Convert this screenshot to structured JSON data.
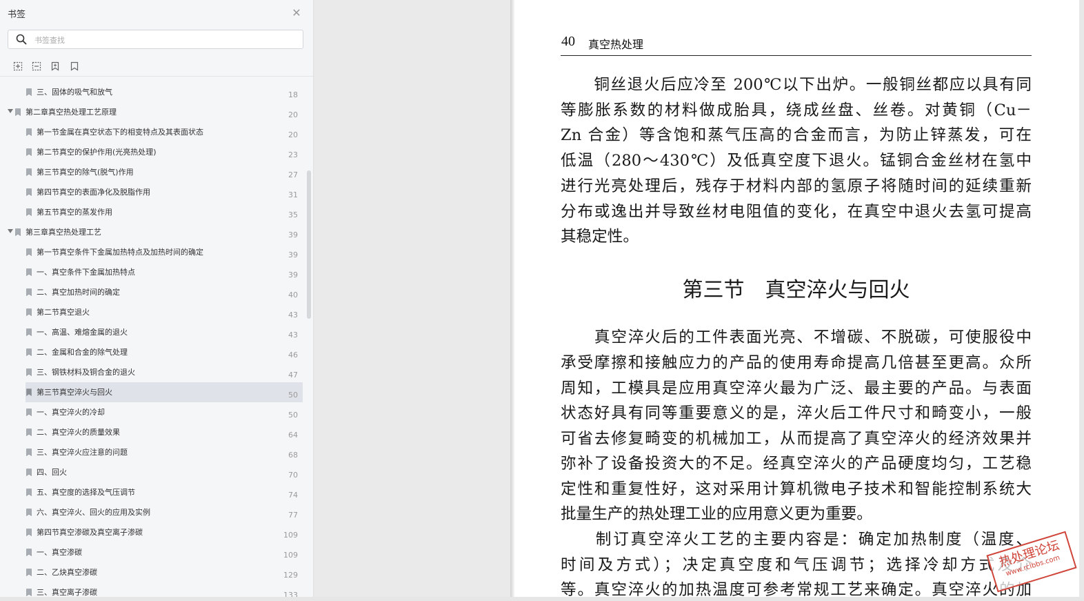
{
  "sidebar": {
    "title": "书签",
    "search_placeholder": "书签查找",
    "bookmarks": [
      {
        "label": "三、固体的吸气和放气",
        "page": "18",
        "level": 2
      },
      {
        "label": "第二章真空热处理工艺原理",
        "page": "20",
        "level": 0,
        "expanded": true
      },
      {
        "label": "第一节金属在真空状态下的相变特点及其表面状态",
        "page": "20",
        "level": 1
      },
      {
        "label": "第二节真空的保护作用(光亮热处理)",
        "page": "23",
        "level": 1
      },
      {
        "label": "第三节真空的除气(脱气)作用",
        "page": "27",
        "level": 1
      },
      {
        "label": "第四节真空的表面净化及脱脂作用",
        "page": "31",
        "level": 1
      },
      {
        "label": "第五节真空的蒸发作用",
        "page": "35",
        "level": 1
      },
      {
        "label": "第三章真空热处理工艺",
        "page": "39",
        "level": 0,
        "expanded": true
      },
      {
        "label": "第一节真空条件下金属加热特点及加热时间的确定",
        "page": "39",
        "level": 1
      },
      {
        "label": "一、真空条件下金属加热特点",
        "page": "39",
        "level": 2
      },
      {
        "label": "二、真空加热时间的确定",
        "page": "40",
        "level": 2
      },
      {
        "label": "第二节真空退火",
        "page": "43",
        "level": 1
      },
      {
        "label": "一、高温、难熔金属的退火",
        "page": "43",
        "level": 2
      },
      {
        "label": "二、金属和合金的除气处理",
        "page": "46",
        "level": 2
      },
      {
        "label": "三、钢铁材料及铜合金的退火",
        "page": "47",
        "level": 2
      },
      {
        "label": "第三节真空淬火与回火",
        "page": "50",
        "level": 1,
        "selected": true
      },
      {
        "label": "一、真空淬火的冷却",
        "page": "50",
        "level": 2
      },
      {
        "label": "二、真空淬火的质量效果",
        "page": "64",
        "level": 2
      },
      {
        "label": "三、真空淬火应注意的问题",
        "page": "68",
        "level": 2
      },
      {
        "label": "四、回火",
        "page": "70",
        "level": 2
      },
      {
        "label": "五、真空度的选择及气压调节",
        "page": "74",
        "level": 2
      },
      {
        "label": "六、真空淬火、回火的应用及实例",
        "page": "77",
        "level": 2
      },
      {
        "label": "第四节真空渗碳及真空离子渗碳",
        "page": "109",
        "level": 1
      },
      {
        "label": "一、真空渗碳",
        "page": "109",
        "level": 2
      },
      {
        "label": "二、乙炔真空渗碳",
        "page": "129",
        "level": 2
      },
      {
        "label": "三、真空离子渗碳",
        "page": "133",
        "level": 2
      }
    ]
  },
  "document": {
    "page_number": "40",
    "running_header": "真空热处理",
    "section_title": "第三节　真空淬火与回火",
    "lines": [
      {
        "text": "　　铜丝退火后应冷至 200℃以下出炉。一般铜丝都应以具有同",
        "just": true
      },
      {
        "text": "等膨胀系数的材料做成胎具，绕成丝盘、丝卷。对黄铜（Cu－",
        "just": true
      },
      {
        "text": "Zn 合金）等含饱和蒸气压高的合金而言，为防止锌蒸发，可在",
        "just": true
      },
      {
        "text": "低温（280～430℃）及低真空度下退火。锰铜合金丝材在氢中",
        "just": true
      },
      {
        "text": "进行光亮处理后，残存于材料内部的氢原子将随时间的延续重新",
        "just": true
      },
      {
        "text": "分布或逸出并导致丝材电阻值的变化，在真空中退火去氢可提高",
        "just": true
      },
      {
        "text": "其稳定性。",
        "just": false
      },
      {
        "text": "　　真空淬火后的工件表面光亮、不增碳、不脱碳，可使服役中",
        "just": true
      },
      {
        "text": "承受摩擦和接触应力的产品的使用寿命提高几倍甚至更高。众所",
        "just": true
      },
      {
        "text": "周知，工模具是应用真空淬火最为广泛、最主要的产品。与表面",
        "just": true
      },
      {
        "text": "状态好具有同等重要意义的是，淬火后工件尺寸和畸变小，一般",
        "just": true
      },
      {
        "text": "可省去修复畸变的机械加工，从而提高了真空淬火的经济效果并",
        "just": true
      },
      {
        "text": "弥补了设备投资大的不足。经真空淬火的产品硬度均匀，工艺稳",
        "just": true
      },
      {
        "text": "定性和重复性好，这对采用计算机微电子技术和智能控制系统大",
        "just": true
      },
      {
        "text": "批量生产的热处理工业的应用意义更为重要。",
        "just": false
      },
      {
        "text": "　　制订真空淬火工艺的主要内容是：确定加热制度（温度、",
        "just": true
      },
      {
        "text": "时间及方式）；决定真空度和气压调节；选择冷却方式及介",
        "just": true
      },
      {
        "text": "等。真空淬火的加热温度可参考常规工艺来确定。真空淬火的加",
        "just": true
      }
    ]
  },
  "watermark": {
    "line1": "热处理论坛",
    "line2": "www.rclbbs.com"
  },
  "colors": {
    "sidebar_bg": "#f5f6f8",
    "selected_row": "#dfe3e9",
    "stamp": "#d0453a"
  }
}
